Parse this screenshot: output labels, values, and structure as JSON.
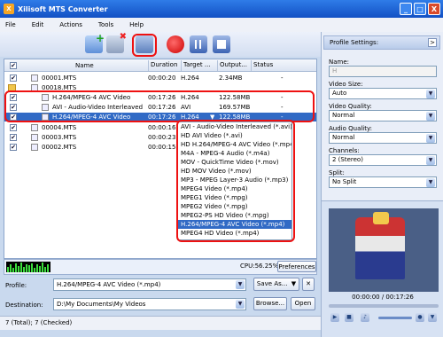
{
  "window": {
    "title": "Xilisoft MTS Converter",
    "buttons": [
      "_",
      "□",
      "X"
    ]
  },
  "menu": [
    "File",
    "Edit",
    "Actions",
    "Tools",
    "Help"
  ],
  "file_list": {
    "columns": [
      "Name",
      "Duration",
      "Target ...",
      "Output...",
      "Status"
    ],
    "rows": [
      {
        "check": "✔",
        "name": "00001.MTS",
        "duration": "00:00:20",
        "target": "H.264",
        "output": "2.34MB",
        "status": "-"
      },
      {
        "check": "",
        "name": "00018.MTS",
        "duration": "",
        "target": "",
        "output": "",
        "status": ""
      },
      {
        "check": "✔",
        "name": "H.264/MPEG-4 AVC Video",
        "duration": "00:17:26",
        "target": "H.264",
        "output": "122.58MB",
        "status": "-"
      },
      {
        "check": "✔",
        "name": "AVI - Audio-Video Interleaved",
        "duration": "00:17:26",
        "target": "AVI",
        "output": "169.57MB",
        "status": "-"
      },
      {
        "check": "✔",
        "name": "H.264/MPEG-4 AVC Video",
        "duration": "00:17:26",
        "target": "H.264",
        "output": "122.58MB",
        "status": "-"
      },
      {
        "check": "✔",
        "name": "00004.MTS",
        "duration": "00:00:16",
        "target": "",
        "output": "",
        "status": ""
      },
      {
        "check": "✔",
        "name": "00003.MTS",
        "duration": "00:00:23",
        "target": "",
        "output": "",
        "status": ""
      },
      {
        "check": "✔",
        "name": "00002.MTS",
        "duration": "00:00:15",
        "target": "",
        "output": "",
        "status": ""
      }
    ]
  },
  "format_dropdown": {
    "items": [
      "AVI - Audio-Video Interleaved (*.avi)",
      "HD AVI Video (*.avi)",
      "HD H.264/MPEG-4 AVC Video (*.mp4)",
      "M4A - MPEG-4 Audio (*.m4a)",
      "MOV - QuickTime Video (*.mov)",
      "HD MOV Video (*.mov)",
      "MP3 - MPEG Layer-3 Audio (*.mp3)",
      "MPEG4 Video (*.mp4)",
      "MPEG1 Video (*.mpg)",
      "MPEG2 Video (*.mpg)",
      "MPEG2-PS HD Video (*.mpg)",
      "H.264/MPEG-4 AVC Video (*.mp4)",
      "MPEG4 HD Video (*.mp4)"
    ]
  },
  "cpu": {
    "text": "CPU:56.25%",
    "preferences_label": "Preferences"
  },
  "profile": {
    "label": "Profile:",
    "value": "H.264/MPEG-4 AVC Video (*.mp4)",
    "save_as_label": "Save As...",
    "delete_icon": "✕"
  },
  "destination": {
    "label": "Destination:",
    "value": "D:\\My Documents\\My Videos",
    "browse_label": "Browse...",
    "open_label": "Open"
  },
  "status": "7 (Total); 7 (Checked)",
  "profile_settings": {
    "header": "Profile Settings:",
    "name_label": "Name:",
    "name_value": "H",
    "video_size_label": "Video Size:",
    "video_size_value": "Auto",
    "video_quality_label": "Video Quality:",
    "video_quality_value": "Normal",
    "audio_quality_label": "Audio Quality:",
    "audio_quality_value": "Normal",
    "channels_label": "Channels:",
    "channels_value": "2 (Stereo)",
    "split_label": "Split:",
    "split_value": "No Split"
  },
  "preview": {
    "time": "00:00:00 / 00:17:26"
  },
  "colors": {
    "selection": "#316ac5",
    "highlight_outline": "#e11111",
    "titlebar": "#1a5dd6"
  }
}
